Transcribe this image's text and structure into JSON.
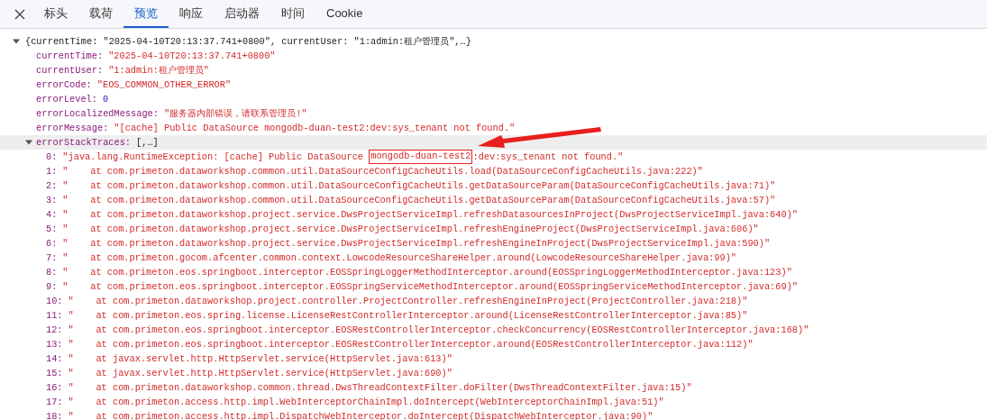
{
  "tabs": [
    {
      "label": "标头",
      "selected": false
    },
    {
      "label": "载荷",
      "selected": false
    },
    {
      "label": "预览",
      "selected": true
    },
    {
      "label": "响应",
      "selected": false
    },
    {
      "label": "启动器",
      "selected": false
    },
    {
      "label": "时间",
      "selected": false
    },
    {
      "label": "Cookie",
      "selected": false
    }
  ],
  "tree": {
    "expanded": true,
    "summary": "{currentTime: \"2025-04-10T20:13:37.741+0800\", currentUser: \"1:admin:租户管理员\",…}",
    "children": [
      {
        "key": "currentTime:",
        "kind": "string",
        "value": "\"2025-04-10T20:13:37.741+0800\""
      },
      {
        "key": "currentUser:",
        "kind": "string",
        "value": "\"1:admin:租户管理员\""
      },
      {
        "key": "errorCode:",
        "kind": "string",
        "value": "\"EOS_COMMON_OTHER_ERROR\""
      },
      {
        "key": "errorLevel:",
        "kind": "number",
        "value": "0"
      },
      {
        "key": "errorLocalizedMessage:",
        "kind": "string",
        "value": "\"服务器内部错误，请联系管理员!\""
      },
      {
        "key": "errorMessage:",
        "kind": "string",
        "value": "\"[cache] Public DataSource mongodb-duan-test2:dev:sys_tenant not found.\""
      },
      {
        "key": "errorStackTraces:",
        "kind": "array",
        "expanded": true,
        "hovered": true,
        "summary": "[,…]",
        "children": [
          {
            "key": "0:",
            "parts": [
              {
                "text": "\"java.lang.RuntimeException: [cache] Public DataSource ",
                "boxed": false
              },
              {
                "text": "mongodb-duan-test2",
                "boxed": true
              },
              {
                "text": ":dev:sys_tenant not found.\"",
                "boxed": false
              }
            ]
          },
          {
            "key": "1:",
            "value": "\"    at com.primeton.dataworkshop.common.util.DataSourceConfigCacheUtils.load(DataSourceConfigCacheUtils.java:222)\""
          },
          {
            "key": "2:",
            "value": "\"    at com.primeton.dataworkshop.common.util.DataSourceConfigCacheUtils.getDataSourceParam(DataSourceConfigCacheUtils.java:71)\""
          },
          {
            "key": "3:",
            "value": "\"    at com.primeton.dataworkshop.common.util.DataSourceConfigCacheUtils.getDataSourceParam(DataSourceConfigCacheUtils.java:57)\""
          },
          {
            "key": "4:",
            "value": "\"    at com.primeton.dataworkshop.project.service.DwsProjectServiceImpl.refreshDatasourcesInProject(DwsProjectServiceImpl.java:640)\""
          },
          {
            "key": "5:",
            "value": "\"    at com.primeton.dataworkshop.project.service.DwsProjectServiceImpl.refreshEngineProject(DwsProjectServiceImpl.java:606)\""
          },
          {
            "key": "6:",
            "value": "\"    at com.primeton.dataworkshop.project.service.DwsProjectServiceImpl.refreshEngineInProject(DwsProjectServiceImpl.java:590)\""
          },
          {
            "key": "7:",
            "value": "\"    at com.primeton.gocom.afcenter.common.context.LowcodeResourceShareHelper.around(LowcodeResourceShareHelper.java:99)\""
          },
          {
            "key": "8:",
            "value": "\"    at com.primeton.eos.springboot.interceptor.EOSSpringLoggerMethodInterceptor.around(EOSSpringLoggerMethodInterceptor.java:123)\""
          },
          {
            "key": "9:",
            "value": "\"    at com.primeton.eos.springboot.interceptor.EOSSpringServiceMethodInterceptor.around(EOSSpringServiceMethodInterceptor.java:69)\""
          },
          {
            "key": "10:",
            "value": "\"    at com.primeton.dataworkshop.project.controller.ProjectController.refreshEngineInProject(ProjectController.java:218)\""
          },
          {
            "key": "11:",
            "value": "\"    at com.primeton.eos.spring.license.LicenseRestControllerInterceptor.around(LicenseRestControllerInterceptor.java:85)\""
          },
          {
            "key": "12:",
            "value": "\"    at com.primeton.eos.springboot.interceptor.EOSRestControllerInterceptor.checkConcurrency(EOSRestControllerInterceptor.java:168)\""
          },
          {
            "key": "13:",
            "value": "\"    at com.primeton.eos.springboot.interceptor.EOSRestControllerInterceptor.around(EOSRestControllerInterceptor.java:112)\""
          },
          {
            "key": "14:",
            "value": "\"    at javax.servlet.http.HttpServlet.service(HttpServlet.java:613)\""
          },
          {
            "key": "15:",
            "value": "\"    at javax.servlet.http.HttpServlet.service(HttpServlet.java:690)\""
          },
          {
            "key": "16:",
            "value": "\"    at com.primeton.dataworkshop.common.thread.DwsThreadContextFilter.doFilter(DwsThreadContextFilter.java:15)\""
          },
          {
            "key": "17:",
            "value": "\"    at com.primeton.access.http.impl.WebInterceptorChainImpl.doIntercept(WebInterceptorChainImpl.java:51)\""
          },
          {
            "key": "18:",
            "value": "\"    at com.primeton.access.http.impl.DispatchWebInterceptor.doIntercept(DispatchWebInterceptor.java:90)\""
          }
        ]
      }
    ]
  }
}
